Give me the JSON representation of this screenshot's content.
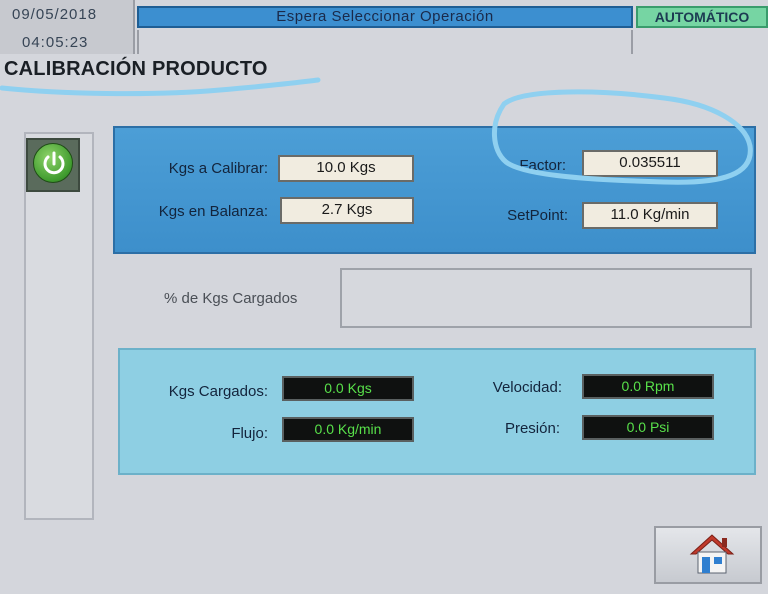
{
  "header": {
    "date": "09/05/2018",
    "time": "04:05:23",
    "status": "Espera Seleccionar Operación",
    "mode": "AUTOMÁTICO"
  },
  "page_title": "CALIBRACIÓN PRODUCTO",
  "calibration": {
    "kgs_calibrar_label": "Kgs a Calibrar:",
    "kgs_calibrar_value": "10.0 Kgs",
    "kgs_balanza_label": "Kgs en Balanza:",
    "kgs_balanza_value": "2.7 Kgs",
    "factor_label": "Factor:",
    "factor_value": "0.035511",
    "setpoint_label": "SetPoint:",
    "setpoint_value": "11.0 Kg/min"
  },
  "progress": {
    "label": "% de Kgs Cargados"
  },
  "readings": {
    "kgs_cargados_label": "Kgs Cargados:",
    "kgs_cargados_value": "0.0 Kgs",
    "flujo_label": "Flujo:",
    "flujo_value": "0.0 Kg/min",
    "velocidad_label": "Velocidad:",
    "velocidad_value": "0.0 Rpm",
    "presion_label": "Presión:",
    "presion_value": "0.0 Psi"
  },
  "icons": {
    "power": "power-icon",
    "home": "home-icon"
  },
  "colors": {
    "status_bar": "#3c8fd0",
    "mode_bar": "#76d5a3",
    "panel_top": "#3d8fcb",
    "panel_bottom": "#8ecfe3",
    "readout_text": "#58e04a",
    "annotation": "#8fd0f0"
  }
}
